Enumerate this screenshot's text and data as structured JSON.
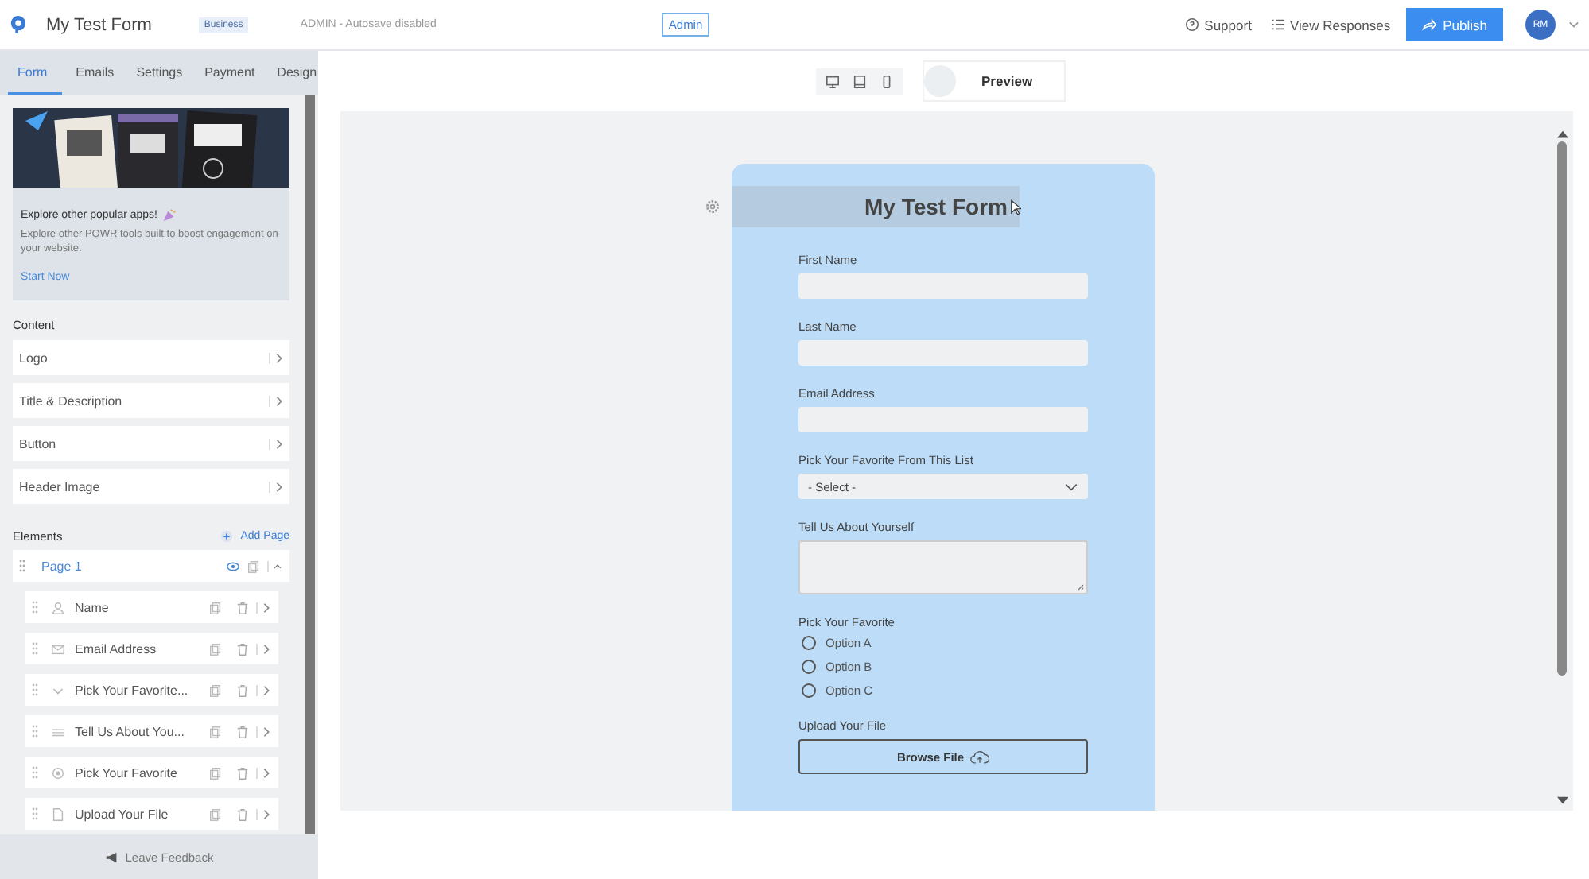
{
  "header": {
    "title": "My Test Form",
    "badge": "Business",
    "status": "ADMIN - Autosave disabled",
    "admin": "Admin",
    "links": [
      {
        "kind": "support",
        "label": "Support"
      },
      {
        "kind": "responses",
        "label": "View Responses"
      }
    ],
    "publish": "Publish",
    "avatar": "RM"
  },
  "sidebar": {
    "tabs": [
      {
        "label": "Form",
        "selected": true
      },
      {
        "label": "Emails",
        "selected": false
      },
      {
        "label": "Settings",
        "selected": false
      },
      {
        "label": "Payment",
        "selected": false
      },
      {
        "label": "Design",
        "selected": false
      }
    ],
    "promo": {
      "title": "Explore other popular apps!",
      "body": "Explore other POWR tools built to boost engagement on your website.",
      "link": "Start Now"
    },
    "content": {
      "heading": "Content",
      "items": [
        "Logo",
        "Title & Description",
        "Button",
        "Header Image"
      ]
    },
    "elements": {
      "heading": "Elements",
      "add_page": "Add Page",
      "page": {
        "label": "Page 1",
        "expanded": true
      },
      "fields": [
        {
          "kind": "person",
          "label": "Name"
        },
        {
          "kind": "email",
          "label": "Email Address"
        },
        {
          "kind": "dropdown",
          "label": "Pick Your Favorite..."
        },
        {
          "kind": "text",
          "label": "Tell Us About You..."
        },
        {
          "kind": "radio",
          "label": "Pick Your Favorite"
        },
        {
          "kind": "file",
          "label": "Upload Your File"
        }
      ]
    },
    "feedback": "Leave Feedback"
  },
  "preview": {
    "devices": [
      {
        "kind": "desktop"
      },
      {
        "kind": "tablet"
      },
      {
        "kind": "phone"
      }
    ],
    "label": "Preview",
    "form": {
      "title": "My Test Form",
      "fields": [
        {
          "kind": "input",
          "label": "First Name"
        },
        {
          "kind": "input",
          "label": "Last Name"
        },
        {
          "kind": "input",
          "label": "Email Address"
        },
        {
          "kind": "select",
          "label": "Pick Your Favorite From This List",
          "value": "- Select -"
        },
        {
          "kind": "textarea",
          "label": "Tell Us About Yourself"
        },
        {
          "kind": "radio",
          "label": "Pick Your Favorite",
          "options": [
            {
              "label": "Option A",
              "selected": false
            },
            {
              "label": "Option B",
              "selected": false
            },
            {
              "label": "Option C",
              "selected": false
            }
          ]
        },
        {
          "kind": "file",
          "label": "Upload Your File",
          "button": "Browse File"
        }
      ]
    }
  }
}
